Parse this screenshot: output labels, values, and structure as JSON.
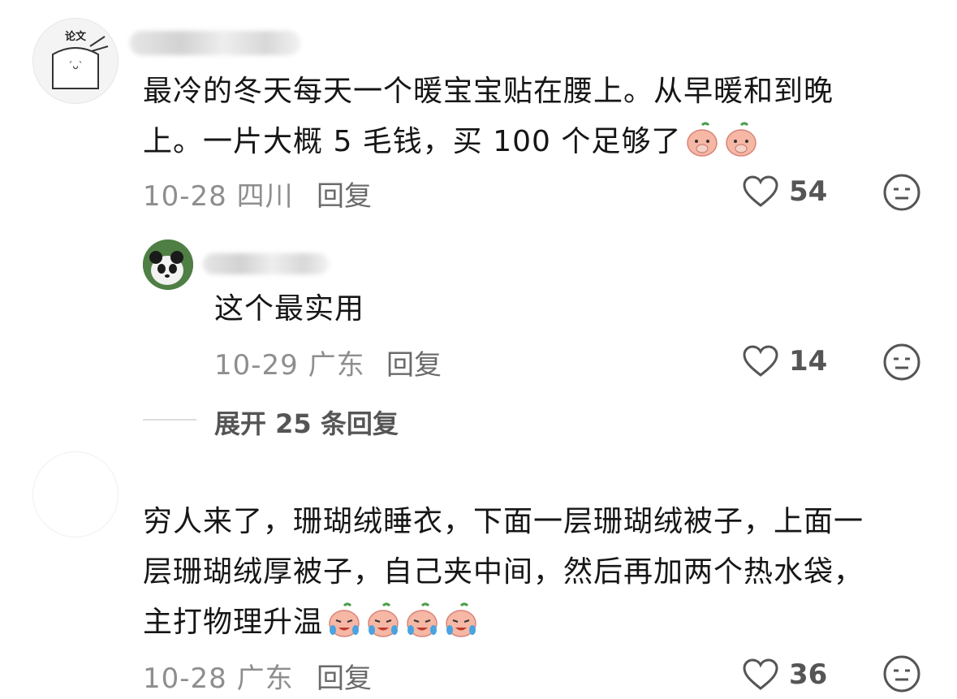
{
  "comments": [
    {
      "avatar_text": "论文",
      "text_line1": "最冷的冬天每天一个暖宝宝贴在腰上。从早暖和到晚",
      "text_line2": "上。一片大概 5 毛钱，买 100 个足够了",
      "date": "10-28",
      "location": "四川",
      "reply_label": "回复",
      "likes": "54",
      "emoji": "peach-cover-face"
    },
    {
      "text_line1": "穷人来了，珊瑚绒睡衣，下面一层珊瑚绒被子，上面一",
      "text_line2": "层珊瑚绒厚被子，自己夹中间，然后再加两个热水袋，",
      "text_line3": "主打物理升温",
      "date": "10-28",
      "location": "广东",
      "reply_label": "回复",
      "likes": "36",
      "emoji": "peach-crying"
    }
  ],
  "reply": {
    "text": "这个最实用",
    "date": "10-29",
    "location": "广东",
    "reply_label": "回复",
    "likes": "14"
  },
  "expand": {
    "label": "展开 25 条回复"
  },
  "icons": {
    "like": "heart-outline-icon",
    "dislike": "meh-face-icon"
  }
}
